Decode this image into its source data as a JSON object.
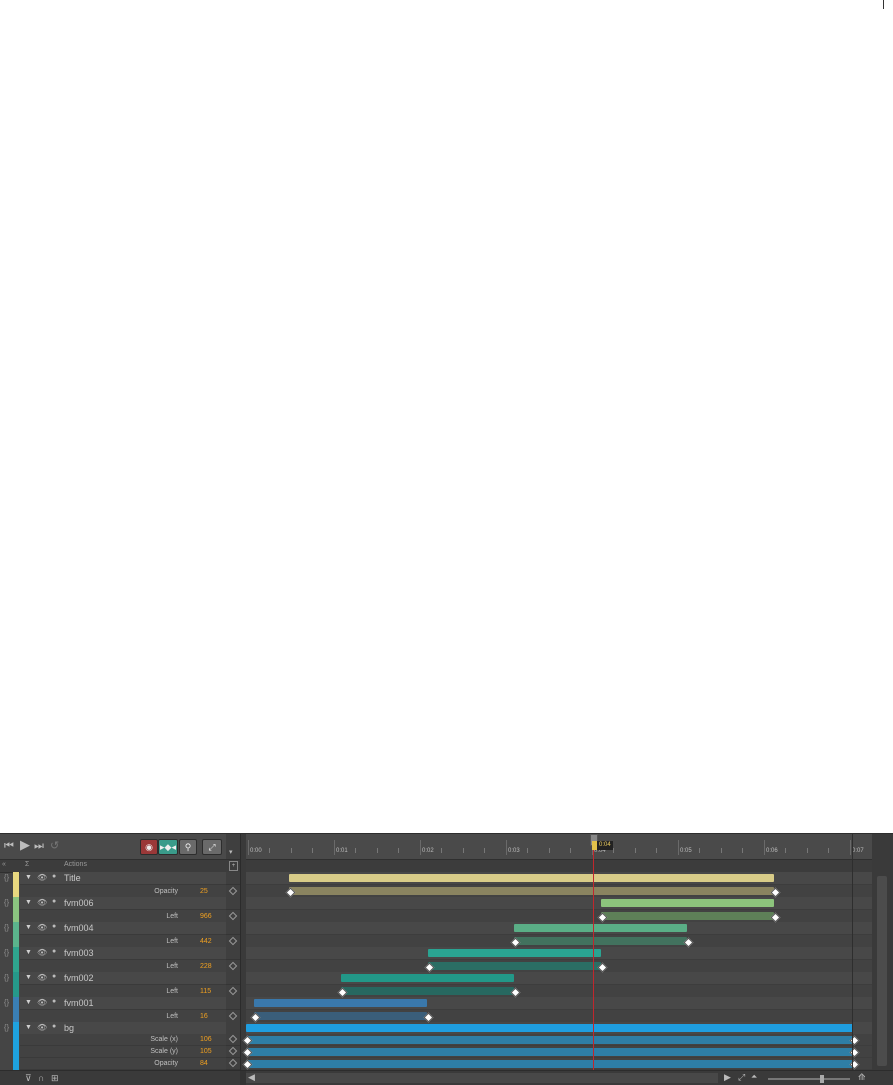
{
  "toolbar": {
    "go_start": "⏮",
    "play": "▶",
    "go_end": "⏭",
    "loop": "↺",
    "record": "◉",
    "autokey": "▸◆◂",
    "pin": "⚲",
    "easing": "⤢"
  },
  "header": {
    "actions_label": "Actions",
    "collapse": "«",
    "sort": "Σ",
    "expand": "▾"
  },
  "ruler": {
    "labels": [
      "0:00",
      "0:01",
      "0:02",
      "0:03",
      "0:04",
      "0:05",
      "0:06",
      "0:07"
    ],
    "current_time": "0:04"
  },
  "layers": [
    {
      "name": "Title",
      "color": "#e8d880",
      "props": [
        {
          "label": "Opacity",
          "value": "25"
        }
      ]
    },
    {
      "name": "fvm006",
      "color": "#8bc480",
      "props": [
        {
          "label": "Left",
          "value": "966"
        }
      ]
    },
    {
      "name": "fvm004",
      "color": "#5bb48c",
      "props": [
        {
          "label": "Left",
          "value": "442"
        }
      ]
    },
    {
      "name": "fvm003",
      "color": "#2fa58e",
      "props": [
        {
          "label": "Left",
          "value": "228"
        }
      ]
    },
    {
      "name": "fvm002",
      "color": "#26998a",
      "props": [
        {
          "label": "Left",
          "value": "115"
        }
      ]
    },
    {
      "name": "fvm001",
      "color": "#3a7fb5",
      "props": [
        {
          "label": "Left",
          "value": "16"
        }
      ]
    },
    {
      "name": "bg",
      "color": "#1fa3e0",
      "props": [
        {
          "label": "Scale (x)",
          "value": "106"
        },
        {
          "label": "Scale (y)",
          "value": "105"
        },
        {
          "label": "Opacity",
          "value": "84"
        }
      ]
    }
  ],
  "bottombar": {
    "filter": "⊽",
    "magnet": "∩",
    "grid": "⊞",
    "scroll_left": "◀",
    "scroll_right": "▶",
    "fit": "⤢",
    "zoom_out": "⏶",
    "zoom_in": "⟰"
  },
  "colors": {
    "panel_bg": "#454545",
    "playhead": "#c0272d"
  }
}
